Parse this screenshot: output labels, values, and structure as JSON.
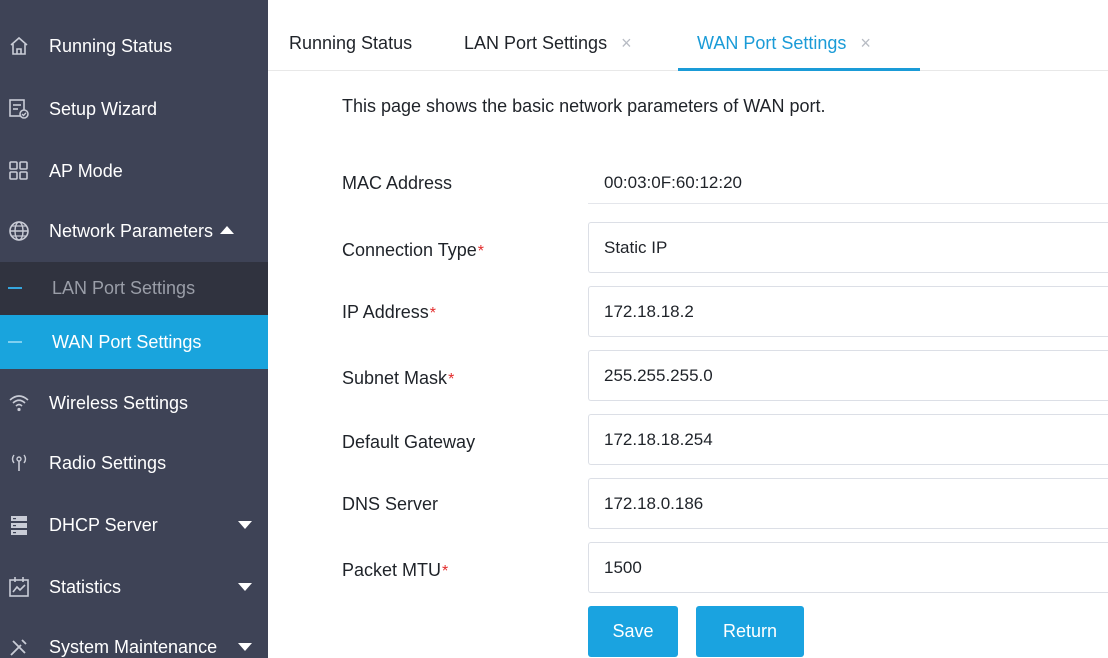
{
  "sidebar": {
    "items": [
      {
        "label": "Running Status",
        "icon": "home-icon"
      },
      {
        "label": "Setup Wizard",
        "icon": "wizard-icon"
      },
      {
        "label": "AP Mode",
        "icon": "ap-mode-icon"
      },
      {
        "label": "Network Parameters",
        "icon": "globe-icon",
        "expanded": true
      },
      {
        "label": "Wireless Settings",
        "icon": "wifi-icon"
      },
      {
        "label": "Radio Settings",
        "icon": "radio-icon"
      },
      {
        "label": "DHCP Server",
        "icon": "server-icon"
      },
      {
        "label": "Statistics",
        "icon": "chart-icon"
      },
      {
        "label": "System Maintenance",
        "icon": "tools-icon"
      }
    ],
    "sub_items": [
      {
        "label": "LAN Port Settings"
      },
      {
        "label": "WAN Port Settings",
        "active": true
      }
    ]
  },
  "tabs": [
    {
      "label": "Running Status",
      "closable": false
    },
    {
      "label": "LAN Port Settings",
      "closable": true
    },
    {
      "label": "WAN Port Settings",
      "closable": true,
      "active": true
    }
  ],
  "tab_close_glyph": "×",
  "required_mark": "*",
  "page": {
    "description": "This page shows the basic network parameters of WAN port."
  },
  "form": {
    "mac_label": "MAC Address",
    "mac_value": "00:03:0F:60:12:20",
    "connection_type_label": "Connection Type",
    "connection_type_value": "Static IP",
    "ip_label": "IP Address",
    "ip_value": "172.18.18.2",
    "subnet_label": "Subnet Mask",
    "subnet_value": "255.255.255.0",
    "gateway_label": "Default Gateway",
    "gateway_value": "172.18.18.254",
    "dns_label": "DNS Server",
    "dns_value": "172.18.0.186",
    "mtu_label": "Packet MTU",
    "mtu_value": "1500"
  },
  "buttons": {
    "save_label": "Save",
    "return_label": "Return"
  },
  "colors": {
    "sidebar_bg": "#3e4356",
    "submenu_bg": "#30333f",
    "accent": "#1a9bd7",
    "required": "#e32b2b"
  }
}
